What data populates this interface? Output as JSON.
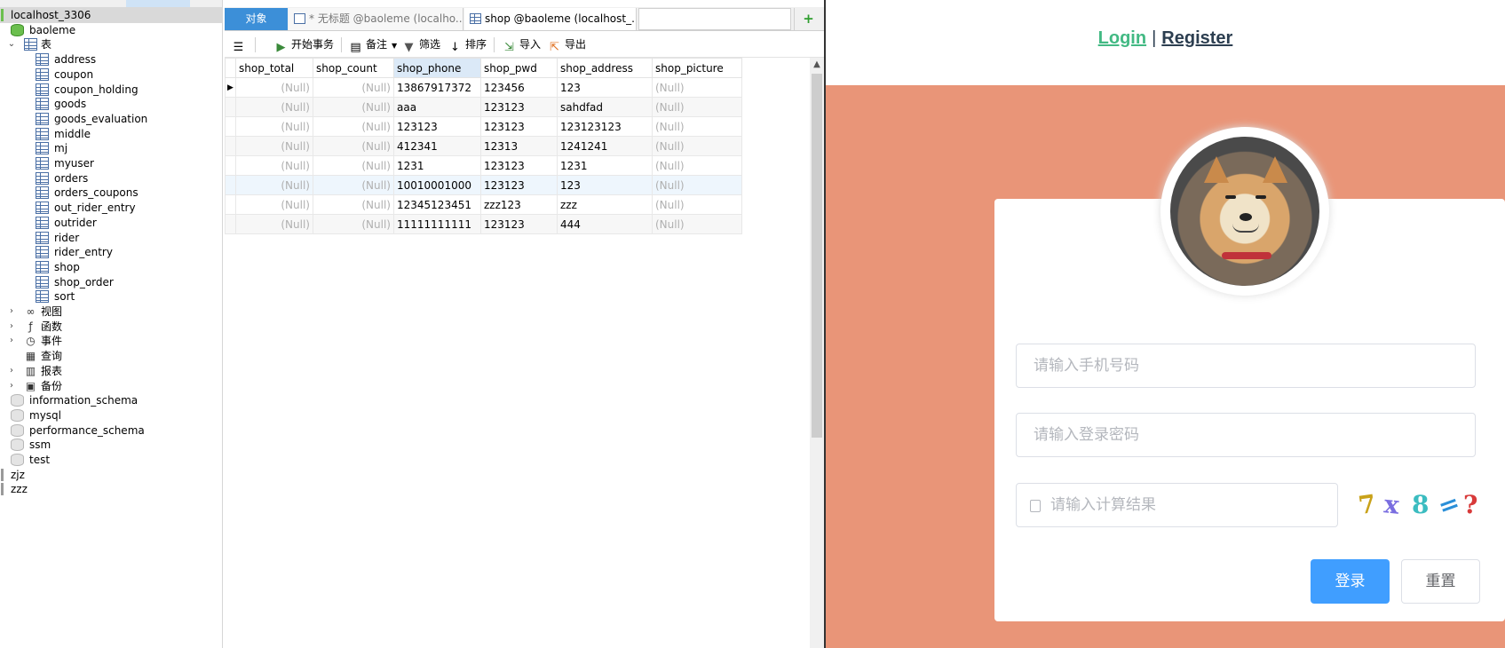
{
  "tree": {
    "nodes": [
      {
        "label": "localhost_3306",
        "icon": "connection-icon",
        "type": "conn",
        "highlight": true
      },
      {
        "label": "baoleme",
        "icon": "database-icon",
        "type": "db"
      },
      {
        "label": "表",
        "icon": "tables-folder-icon",
        "type": "folder",
        "expanded": true
      },
      {
        "label": "address",
        "icon": "table-icon",
        "type": "table"
      },
      {
        "label": "coupon",
        "icon": "table-icon",
        "type": "table"
      },
      {
        "label": "coupon_holding",
        "icon": "table-icon",
        "type": "table"
      },
      {
        "label": "goods",
        "icon": "table-icon",
        "type": "table"
      },
      {
        "label": "goods_evaluation",
        "icon": "table-icon",
        "type": "table"
      },
      {
        "label": "middle",
        "icon": "table-icon",
        "type": "table"
      },
      {
        "label": "mj",
        "icon": "table-icon",
        "type": "table"
      },
      {
        "label": "myuser",
        "icon": "table-icon",
        "type": "table"
      },
      {
        "label": "orders",
        "icon": "table-icon",
        "type": "table"
      },
      {
        "label": "orders_coupons",
        "icon": "table-icon",
        "type": "table"
      },
      {
        "label": "out_rider_entry",
        "icon": "table-icon",
        "type": "table"
      },
      {
        "label": "outrider",
        "icon": "table-icon",
        "type": "table"
      },
      {
        "label": "rider",
        "icon": "table-icon",
        "type": "table"
      },
      {
        "label": "rider_entry",
        "icon": "table-icon",
        "type": "table"
      },
      {
        "label": "shop",
        "icon": "table-icon",
        "type": "table"
      },
      {
        "label": "shop_order",
        "icon": "table-icon",
        "type": "table"
      },
      {
        "label": "sort",
        "icon": "table-icon",
        "type": "table"
      },
      {
        "label": "视图",
        "icon": "views-icon",
        "type": "folder"
      },
      {
        "label": "函数",
        "icon": "functions-icon",
        "type": "folder"
      },
      {
        "label": "事件",
        "icon": "events-icon",
        "type": "folder"
      },
      {
        "label": "查询",
        "icon": "queries-icon",
        "type": "folder",
        "noarrow": true
      },
      {
        "label": "报表",
        "icon": "reports-icon",
        "type": "folder"
      },
      {
        "label": "备份",
        "icon": "backup-icon",
        "type": "folder"
      },
      {
        "label": "information_schema",
        "icon": "database-icon",
        "type": "dbgray"
      },
      {
        "label": "mysql",
        "icon": "database-icon",
        "type": "dbgray"
      },
      {
        "label": "performance_schema",
        "icon": "database-icon",
        "type": "dbgray"
      },
      {
        "label": "ssm",
        "icon": "database-icon",
        "type": "dbgray"
      },
      {
        "label": "test",
        "icon": "database-icon",
        "type": "dbgray"
      },
      {
        "label": "zjz",
        "icon": "connection-icon",
        "type": "conngray"
      },
      {
        "label": "zzz",
        "icon": "connection-icon",
        "type": "conngray"
      }
    ]
  },
  "tabs": {
    "objects": "对象",
    "untitled": "* 无标题 @baoleme (localho...",
    "shop": "shop @baoleme (localhost_..."
  },
  "toolbar": {
    "begin_transaction": "开始事务",
    "memo": "备注",
    "filter": "筛选",
    "sort": "排序",
    "import": "导入",
    "export": "导出"
  },
  "grid": {
    "columns": [
      "shop_total",
      "shop_count",
      "shop_phone",
      "shop_pwd",
      "shop_address",
      "shop_picture"
    ],
    "rows": [
      [
        "(Null)",
        "(Null)",
        "13867917372",
        "123456",
        "123",
        "(Null)"
      ],
      [
        "(Null)",
        "(Null)",
        "aaa",
        "123123",
        "sahdfad",
        "(Null)"
      ],
      [
        "(Null)",
        "(Null)",
        "123123",
        "123123",
        "123123123",
        "(Null)"
      ],
      [
        "(Null)",
        "(Null)",
        "412341",
        "12313",
        "1241241",
        "(Null)"
      ],
      [
        "(Null)",
        "(Null)",
        "1231",
        "123123",
        "1231",
        "(Null)"
      ],
      [
        "(Null)",
        "(Null)",
        "10010001000",
        "123123",
        "123",
        "(Null)"
      ],
      [
        "(Null)",
        "(Null)",
        "12345123451",
        "zzz123",
        "zzz",
        "(Null)"
      ],
      [
        "(Null)",
        "(Null)",
        "11111111111",
        "123123",
        "444",
        "(Null)"
      ]
    ]
  },
  "web": {
    "nav": {
      "login": "Login",
      "separator": "|",
      "register": "Register"
    },
    "form": {
      "phone_placeholder": "请输入手机号码",
      "password_placeholder": "请输入登录密码",
      "captcha_placeholder": "请输入计算结果",
      "captcha_chars": [
        "7",
        "x",
        "8",
        "=",
        "?"
      ],
      "login_label": "登录",
      "reset_label": "重置"
    },
    "colors": {
      "background": "#e99578",
      "primary": "#409eff",
      "login_link": "#42b983",
      "register_link": "#2c3e50"
    }
  }
}
